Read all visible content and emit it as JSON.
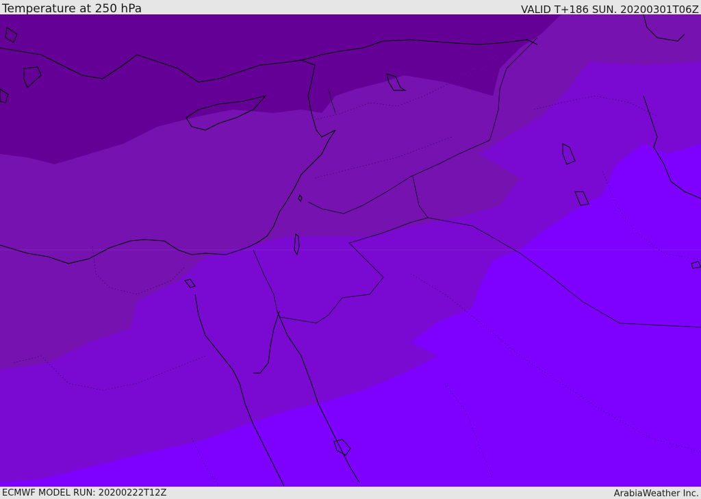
{
  "header": {
    "title": "Temperature at 250 hPa",
    "valid_time": "VALID T+186 SUN. 20200301T06Z"
  },
  "footer": {
    "model_run": "ECMWF MODEL RUN: 20200222T12Z",
    "credit": "ArabiaWeather Inc."
  },
  "map": {
    "region": "Eastern Mediterranean / Middle East",
    "field": "temperature at 250 hPa",
    "colors": {
      "coldest": "#650096",
      "cold": "#7512b0",
      "mild": "#7a0ad2",
      "warm": "#7e00ff",
      "coastline": "#000000",
      "borders": "#1c0033"
    }
  }
}
